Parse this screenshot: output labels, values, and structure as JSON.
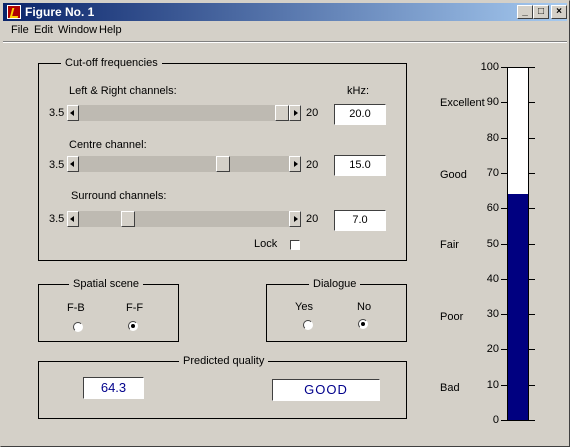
{
  "window": {
    "title": "Figure No. 1",
    "controls": {
      "minimize": "_",
      "maximize": "□",
      "close": "×"
    }
  },
  "menu": [
    "File",
    "Edit",
    "Window",
    "Help"
  ],
  "cutoff": {
    "legend": "Cut-off frequencies",
    "unit_label": "kHz:",
    "min_label": "3.5",
    "max_label": "20",
    "min": 3.5,
    "max": 20,
    "sliders": [
      {
        "label": "Left & Right channels:",
        "value": "20.0",
        "num": 20.0
      },
      {
        "label": "Centre channel:",
        "value": "15.0",
        "num": 15.0
      },
      {
        "label": "Surround channels:",
        "value": "7.0",
        "num": 7.0
      }
    ],
    "lock_label": "Lock",
    "lock_checked": false
  },
  "spatial": {
    "legend": "Spatial scene",
    "options": [
      {
        "label": "F-B",
        "selected": false
      },
      {
        "label": "F-F",
        "selected": true
      }
    ]
  },
  "dialogue": {
    "legend": "Dialogue",
    "options": [
      {
        "label": "Yes",
        "selected": false
      },
      {
        "label": "No",
        "selected": true
      }
    ]
  },
  "predicted": {
    "legend": "Predicted quality",
    "score": "64.3",
    "grade": "GOOD"
  },
  "gauge": {
    "value": 64.3,
    "min": 0,
    "max": 100,
    "fill_color": "#000080",
    "ticks": [
      "0",
      "10",
      "20",
      "30",
      "40",
      "50",
      "60",
      "70",
      "80",
      "90",
      "100"
    ],
    "categories": [
      "Excellent",
      "Good",
      "Fair",
      "Poor",
      "Bad"
    ]
  }
}
